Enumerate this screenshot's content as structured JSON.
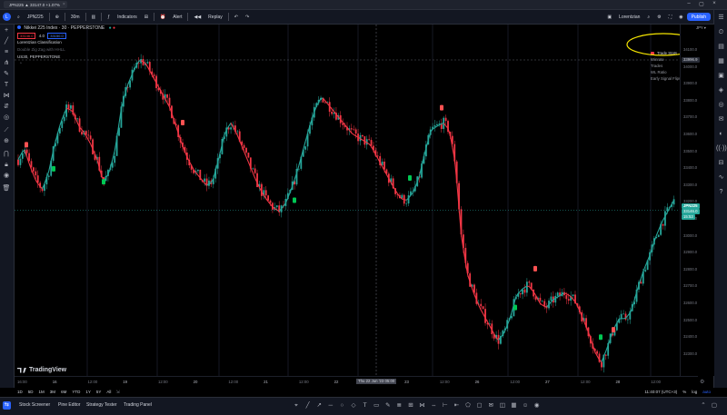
{
  "tab": {
    "title": "JPN225 ▲ 33147.0 +1.07%"
  },
  "toolbar": {
    "symbol": "JPN225",
    "interval": "30m",
    "indicators": "Indicators",
    "alert": "Alert",
    "replay": "Replay",
    "user": "Lorentzian",
    "publish": "Publish",
    "avatar_letter": "L"
  },
  "legend": {
    "title": "Nikkei 225 Index · 30 · PEPPERSTONE",
    "chip1": "33146.0",
    "chip_mid": "4.0",
    "chip2": "33150.0",
    "indicator1": "Lorentzian Classification",
    "indicator2": "Double Zig Zag with HHLL",
    "indicator3": "US30, PEPPERSTONE"
  },
  "stats": {
    "header": "Trade Stats",
    "rows": [
      {
        "label": "Winrate",
        "value": "83.6%"
      },
      {
        "label": "Trades",
        "value": "55 (46|9)"
      },
      {
        "label": "WL Ratio",
        "value": "5.11"
      },
      {
        "label": "Early Signal Flips",
        "value": "0"
      }
    ]
  },
  "price_axis": {
    "ticks": [
      "34100.0",
      "34000.0",
      "33900.0",
      "33800.0",
      "33700.0",
      "33600.0",
      "33500.0",
      "33400.0",
      "33300.0",
      "33200.0",
      "33100.0",
      "33000.0",
      "32900.0",
      "32800.0",
      "32700.0",
      "32600.0",
      "32500.0",
      "32400.0",
      "32300.0"
    ],
    "top_label": "33996.9",
    "current_symbol": "JPN225",
    "current_price": "33146.0",
    "current_countdown": "15:53"
  },
  "time_axis": {
    "ticks": [
      "16:00",
      "16",
      "12:00",
      "19",
      "12:00",
      "20",
      "12:00",
      "21",
      "12:00",
      "22",
      "12:00",
      "23",
      "12:00",
      "26",
      "12:00",
      "27",
      "12:00",
      "28",
      "12:00"
    ],
    "cursor": "Thu 22 Jun '23  05:00"
  },
  "ranges": [
    "1D",
    "5D",
    "1M",
    "3M",
    "6M",
    "YTD",
    "1Y",
    "5Y",
    "All"
  ],
  "clock": "11:40:07 (UTC+3)",
  "branding": "TradingView",
  "bottom_tabs": [
    "Stock Screener",
    "Pine Editor",
    "Strategy Tester",
    "Trading Panel"
  ],
  "colors": {
    "up": "#26a69a",
    "down": "#f23645",
    "accent": "#2962ff",
    "highlight_ellipse": "#f5e500"
  },
  "chart_data": {
    "type": "candlestick",
    "symbol": "Nikkei 225 Index",
    "ylim": [
      32250,
      34150
    ],
    "close_path": [
      33420,
      33480,
      33380,
      33300,
      33260,
      33350,
      33500,
      33620,
      33700,
      33680,
      33600,
      33560,
      33500,
      33420,
      33300,
      33350,
      33480,
      33700,
      33820,
      33900,
      33960,
      33940,
      33880,
      33820,
      33760,
      33700,
      33600,
      33500,
      33420,
      33360,
      33320,
      33280,
      33300,
      33420,
      33560,
      33620,
      33560,
      33480,
      33400,
      33320,
      33250,
      33200,
      33160,
      33140,
      33180,
      33260,
      33360,
      33480,
      33600,
      33700,
      33760,
      33720,
      33680,
      33640,
      33600,
      33560,
      33540,
      33520,
      33500,
      33440,
      33380,
      33320,
      33260,
      33210,
      33200,
      33240,
      33320,
      33460,
      33580,
      33600,
      33620,
      33580,
      33400,
      33000,
      32800,
      32700,
      32620,
      32560,
      32500,
      32440,
      32480,
      32560,
      32680,
      32720,
      32740,
      32700,
      32640,
      32620,
      32660,
      32680,
      32700,
      32680,
      32640,
      32560,
      32480,
      32380,
      32320,
      32400,
      32500,
      32560,
      32560,
      32600,
      32720,
      32820,
      32900,
      33000,
      33080,
      33140,
      33200
    ]
  }
}
